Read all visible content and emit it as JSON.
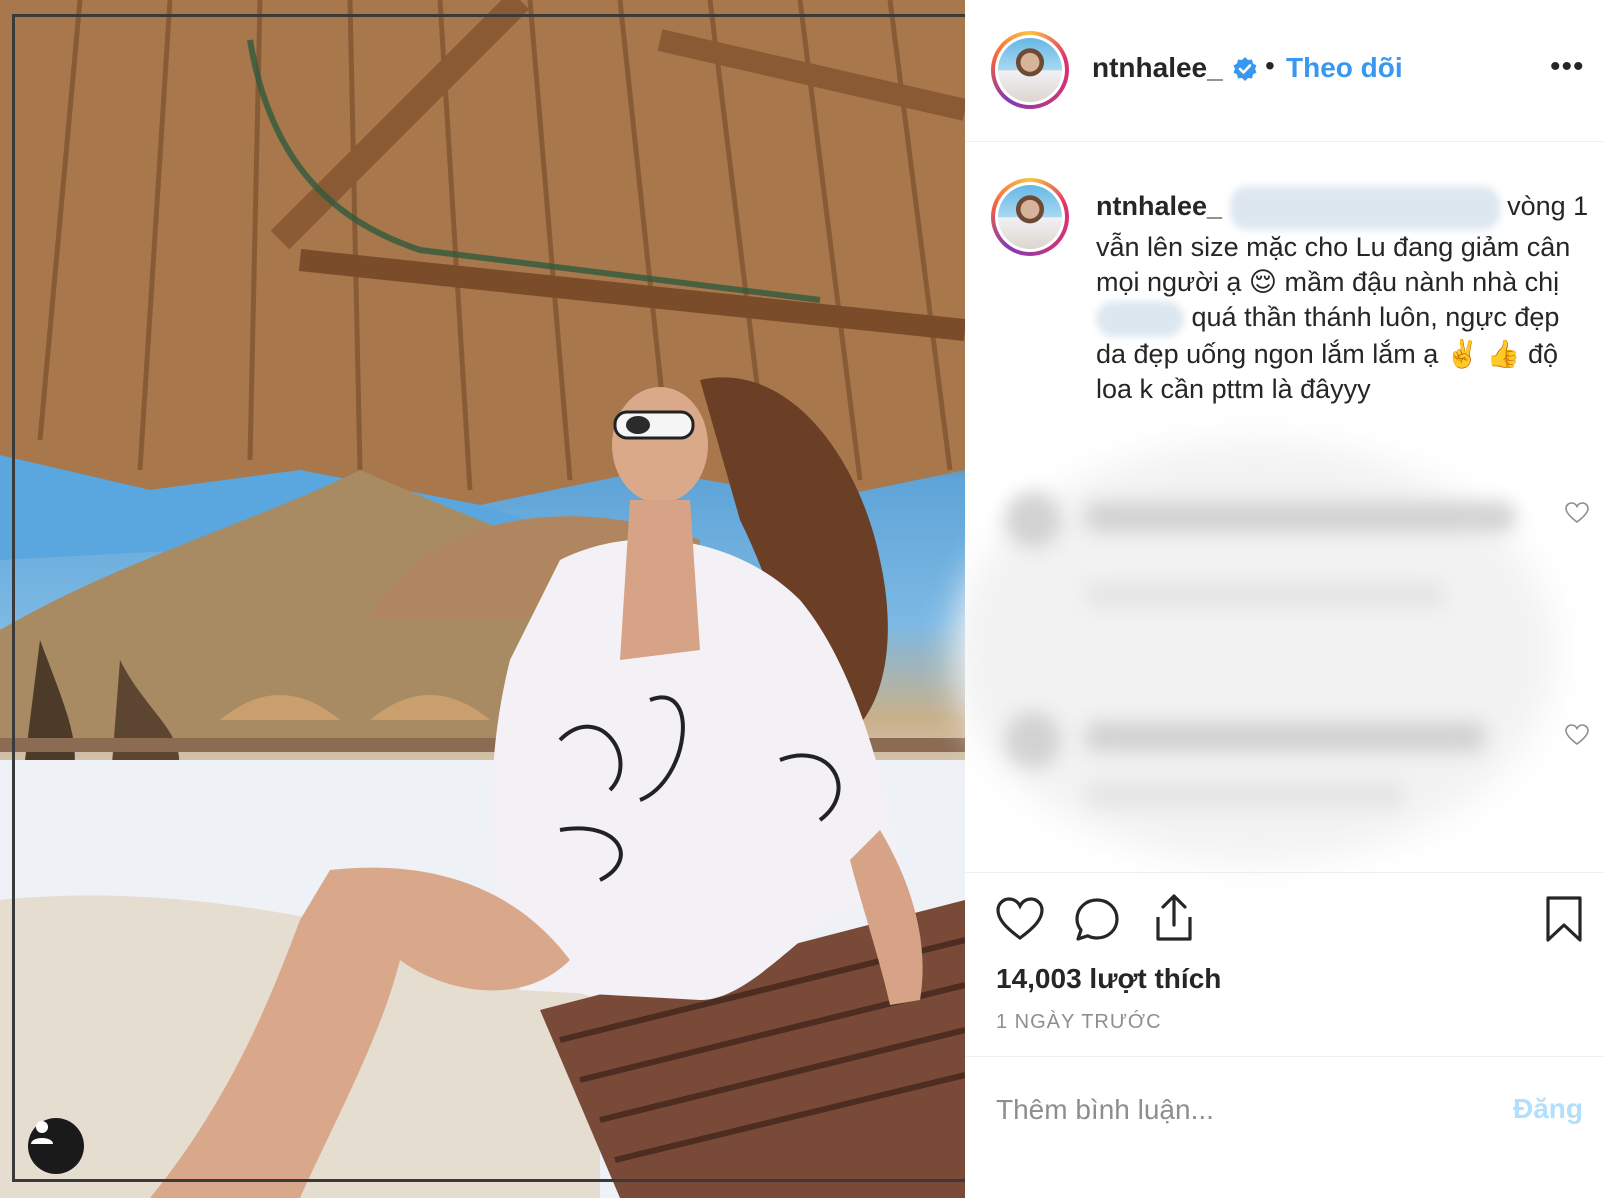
{
  "header": {
    "username": "ntnhalee_",
    "separator": "•",
    "follow_label": "Theo dõi",
    "more_label": "•••",
    "verified_icon": "verified-badge-icon"
  },
  "caption": {
    "username": "ntnhalee_",
    "part1": "vòng 1 vẫn lên size mặc cho Lu đang giảm cân mọi người ạ 😌  mầm đậu nành nhà chị",
    "part2": "quá thần thánh luôn, ngực đẹp da đẹp uống ngon lắm lắm ạ ✌️ 👍  độ loa k cần pttm là đâyyy"
  },
  "actions": {
    "like_icon": "heart-icon",
    "comment_icon": "comment-bubble-icon",
    "share_icon": "share-icon",
    "save_icon": "bookmark-icon"
  },
  "likes_text": "14,003 lượt thích",
  "timestamp": "1 NGÀY TRƯỚC",
  "comment_box": {
    "placeholder": "Thêm bình luận...",
    "post_label": "Đăng"
  },
  "colors": {
    "link_blue": "#3897f0",
    "post_disabled": "#b2dffc",
    "muted": "#8e8e8e"
  }
}
